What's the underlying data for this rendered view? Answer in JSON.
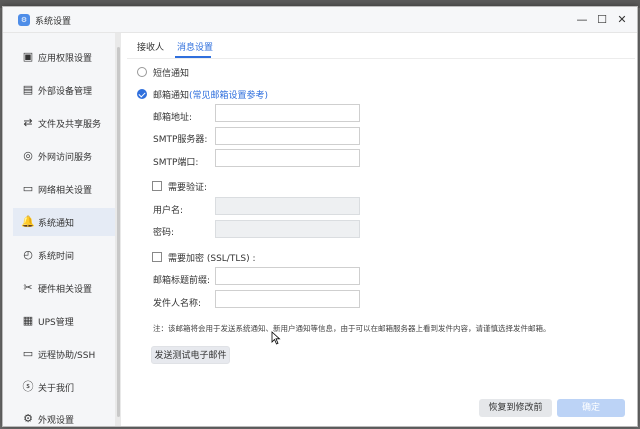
{
  "window": {
    "title": "系统设置",
    "app_icon": "gear-app-icon",
    "controls": {
      "minimize": "—",
      "maximize": "☐",
      "close": "✕"
    }
  },
  "sidebar": {
    "items": [
      {
        "label": "应用权限设置",
        "icon": "app-permission-icon",
        "glyph": "▣",
        "active": false
      },
      {
        "label": "外部设备管理",
        "icon": "external-device-icon",
        "glyph": "▤",
        "active": false
      },
      {
        "label": "文件及共享服务",
        "icon": "file-share-icon",
        "glyph": "⇄",
        "active": false
      },
      {
        "label": "外网访问服务",
        "icon": "network-access-icon",
        "glyph": "◎",
        "active": false
      },
      {
        "label": "网络相关设置",
        "icon": "network-settings-icon",
        "glyph": "▭",
        "active": false
      },
      {
        "label": "系统通知",
        "icon": "bell-icon",
        "glyph": "🔔",
        "active": true
      },
      {
        "label": "系统时间",
        "icon": "globe-clock-icon",
        "glyph": "◴",
        "active": false
      },
      {
        "label": "硬件相关设置",
        "icon": "tools-icon",
        "glyph": "✂",
        "active": false
      },
      {
        "label": "UPS管理",
        "icon": "ups-icon",
        "glyph": "▦",
        "active": false
      },
      {
        "label": "远程协助/SSH",
        "icon": "remote-assist-icon",
        "glyph": "▭",
        "active": false
      },
      {
        "label": "关于我们",
        "icon": "info-icon",
        "glyph": "ⓢ",
        "active": false
      },
      {
        "label": "外观设置",
        "icon": "appearance-gear-icon",
        "glyph": "⚙",
        "active": false
      }
    ]
  },
  "tabs": [
    {
      "label": "接收人",
      "active": false
    },
    {
      "label": "消息设置",
      "active": true
    }
  ],
  "notify": {
    "sms_label": "短信通知",
    "sms_checked": false,
    "email_label": "邮箱通知",
    "email_checked": true,
    "email_ref_link": "(常见邮箱设置参考)"
  },
  "fields": {
    "email_address": {
      "label": "邮箱地址:",
      "value": ""
    },
    "smtp_server": {
      "label": "SMTP服务器:",
      "value": ""
    },
    "smtp_port": {
      "label": "SMTP端口:",
      "value": ""
    },
    "need_auth": {
      "label": "需要验证:",
      "checked": false
    },
    "username": {
      "label": "用户名:",
      "value": ""
    },
    "password": {
      "label": "密码:",
      "value": ""
    },
    "need_encrypt": {
      "label": "需要加密 (SSL/TLS) :",
      "checked": false
    },
    "subject_prefix": {
      "label": "邮箱标题前缀:",
      "value": ""
    },
    "sender_name": {
      "label": "发件人名称:",
      "value": ""
    }
  },
  "note": "注：该邮箱将会用于发送系统通知、新用户通知等信息，由于可以在邮箱服务器上看到发件内容，请谨慎选择发件邮箱。",
  "buttons": {
    "send_test": "发送测试电子邮件",
    "restore": "恢复到修改前",
    "ok": "确定"
  },
  "colors": {
    "accent": "#2f6fdd",
    "active_bg": "#e5ebf5",
    "ok_disabled": "#bcd3f6"
  }
}
